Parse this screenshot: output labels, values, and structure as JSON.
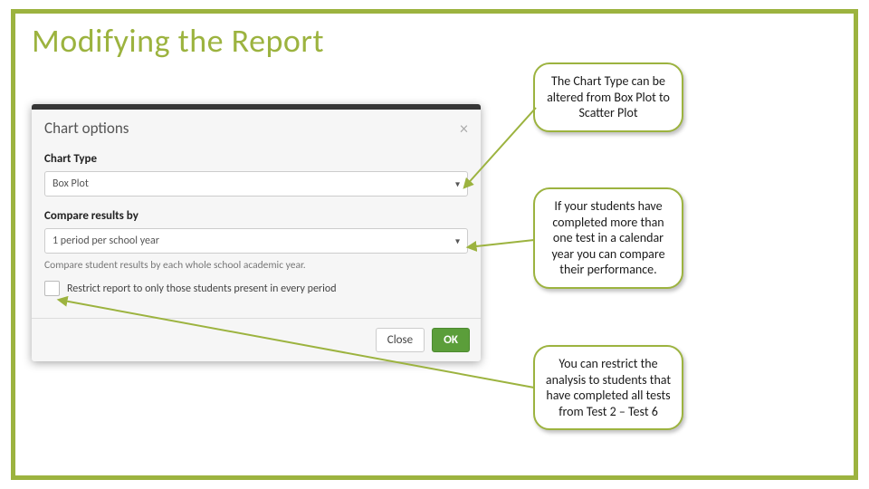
{
  "slide": {
    "title": "Modifying the Report"
  },
  "modal": {
    "title": "Chart options",
    "chartType": {
      "label": "Chart Type",
      "value": "Box Plot"
    },
    "compareBy": {
      "label": "Compare results by",
      "value": "1 period per school year",
      "help": "Compare student results by each whole school academic year."
    },
    "restrict": {
      "label": "Restrict report to only those students present in every period"
    },
    "buttons": {
      "close": "Close",
      "ok": "OK"
    }
  },
  "callouts": {
    "c1": "The Chart Type can be altered from Box Plot to Scatter Plot",
    "c2": "If your students have completed more than one test in a calendar year you can compare their performance.",
    "c3": "You can restrict the analysis to students that have completed all tests from Test 2 – Test 6"
  }
}
